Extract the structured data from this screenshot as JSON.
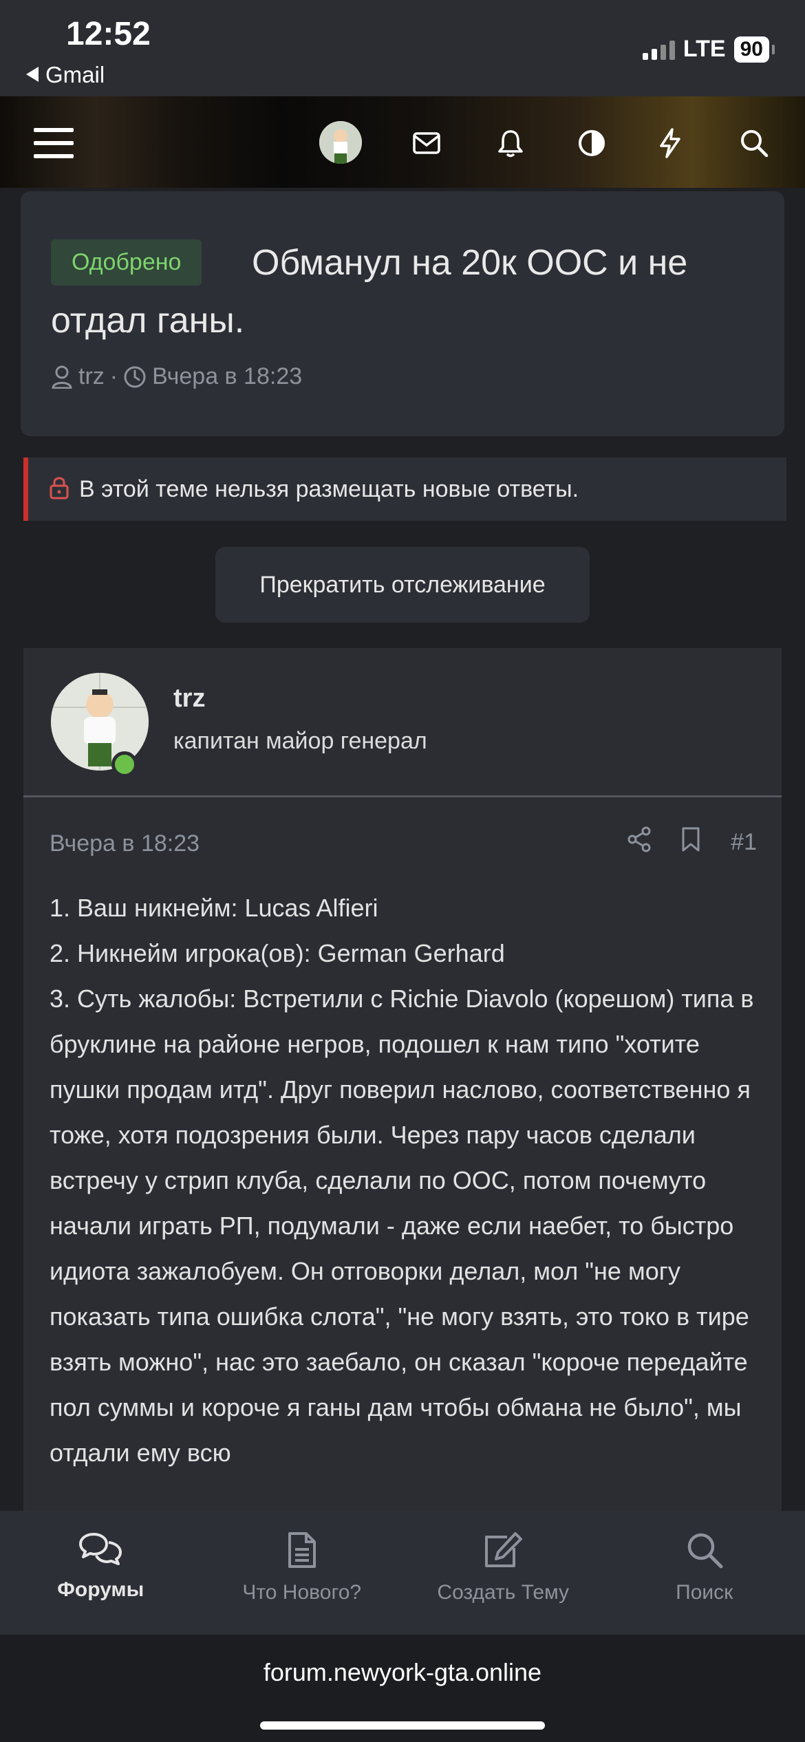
{
  "status_bar": {
    "time": "12:52",
    "back_label": "Gmail",
    "network": "LTE",
    "battery": "90"
  },
  "header": {
    "icons": [
      "menu-icon",
      "avatar",
      "mail-icon",
      "bell-icon",
      "contrast-icon",
      "bolt-icon",
      "search-icon"
    ]
  },
  "thread": {
    "badge": "Одобрено",
    "title": "Обманул на 20к ООС и не отдал ганы.",
    "author": "trz",
    "separator": "·",
    "date": "Вчера в 18:23"
  },
  "notice": {
    "text": "В этой теме нельзя размещать новые ответы."
  },
  "unwatch_button": "Прекратить отслеживание",
  "post": {
    "username": "trz",
    "user_title": "капитан майор генерал",
    "date": "Вчера в 18:23",
    "number": "#1",
    "lines": [
      "1. Ваш никнейм: Lucas Alfieri",
      "2. Никнейм игрока(ов): German Gerhard",
      "3. Суть жалобы: Встретили с Richie Diavolo (корешом) типа в бруклине на районе негров, подошел к нам типо \"хотите пушки продам итд\". Друг поверил наслово, соответственно я тоже, хотя подозрения были. Через пару часов сделали встречу у стрип клуба, сделали по ООС, потом почемуто начали играть РП, подумали - даже если наебет, то быстро идиота зажалобуем. Он отговорки делал, мол \"не могу показать типа ошибка слота\", \"не могу взять, это токо в тире взять можно\", нас это заебало, он сказал \"короче передайте пол суммы и короче я ганы дам чтобы обмана не было\", мы отдали ему всю"
    ]
  },
  "bottom_nav": {
    "items": [
      {
        "label": "Форумы",
        "icon": "forums-icon"
      },
      {
        "label": "Что Нового?",
        "icon": "document-icon"
      },
      {
        "label": "Создать Тему",
        "icon": "edit-icon"
      },
      {
        "label": "Поиск",
        "icon": "search-icon"
      }
    ]
  },
  "browser": {
    "url": "forum.newyork-gta.online"
  }
}
